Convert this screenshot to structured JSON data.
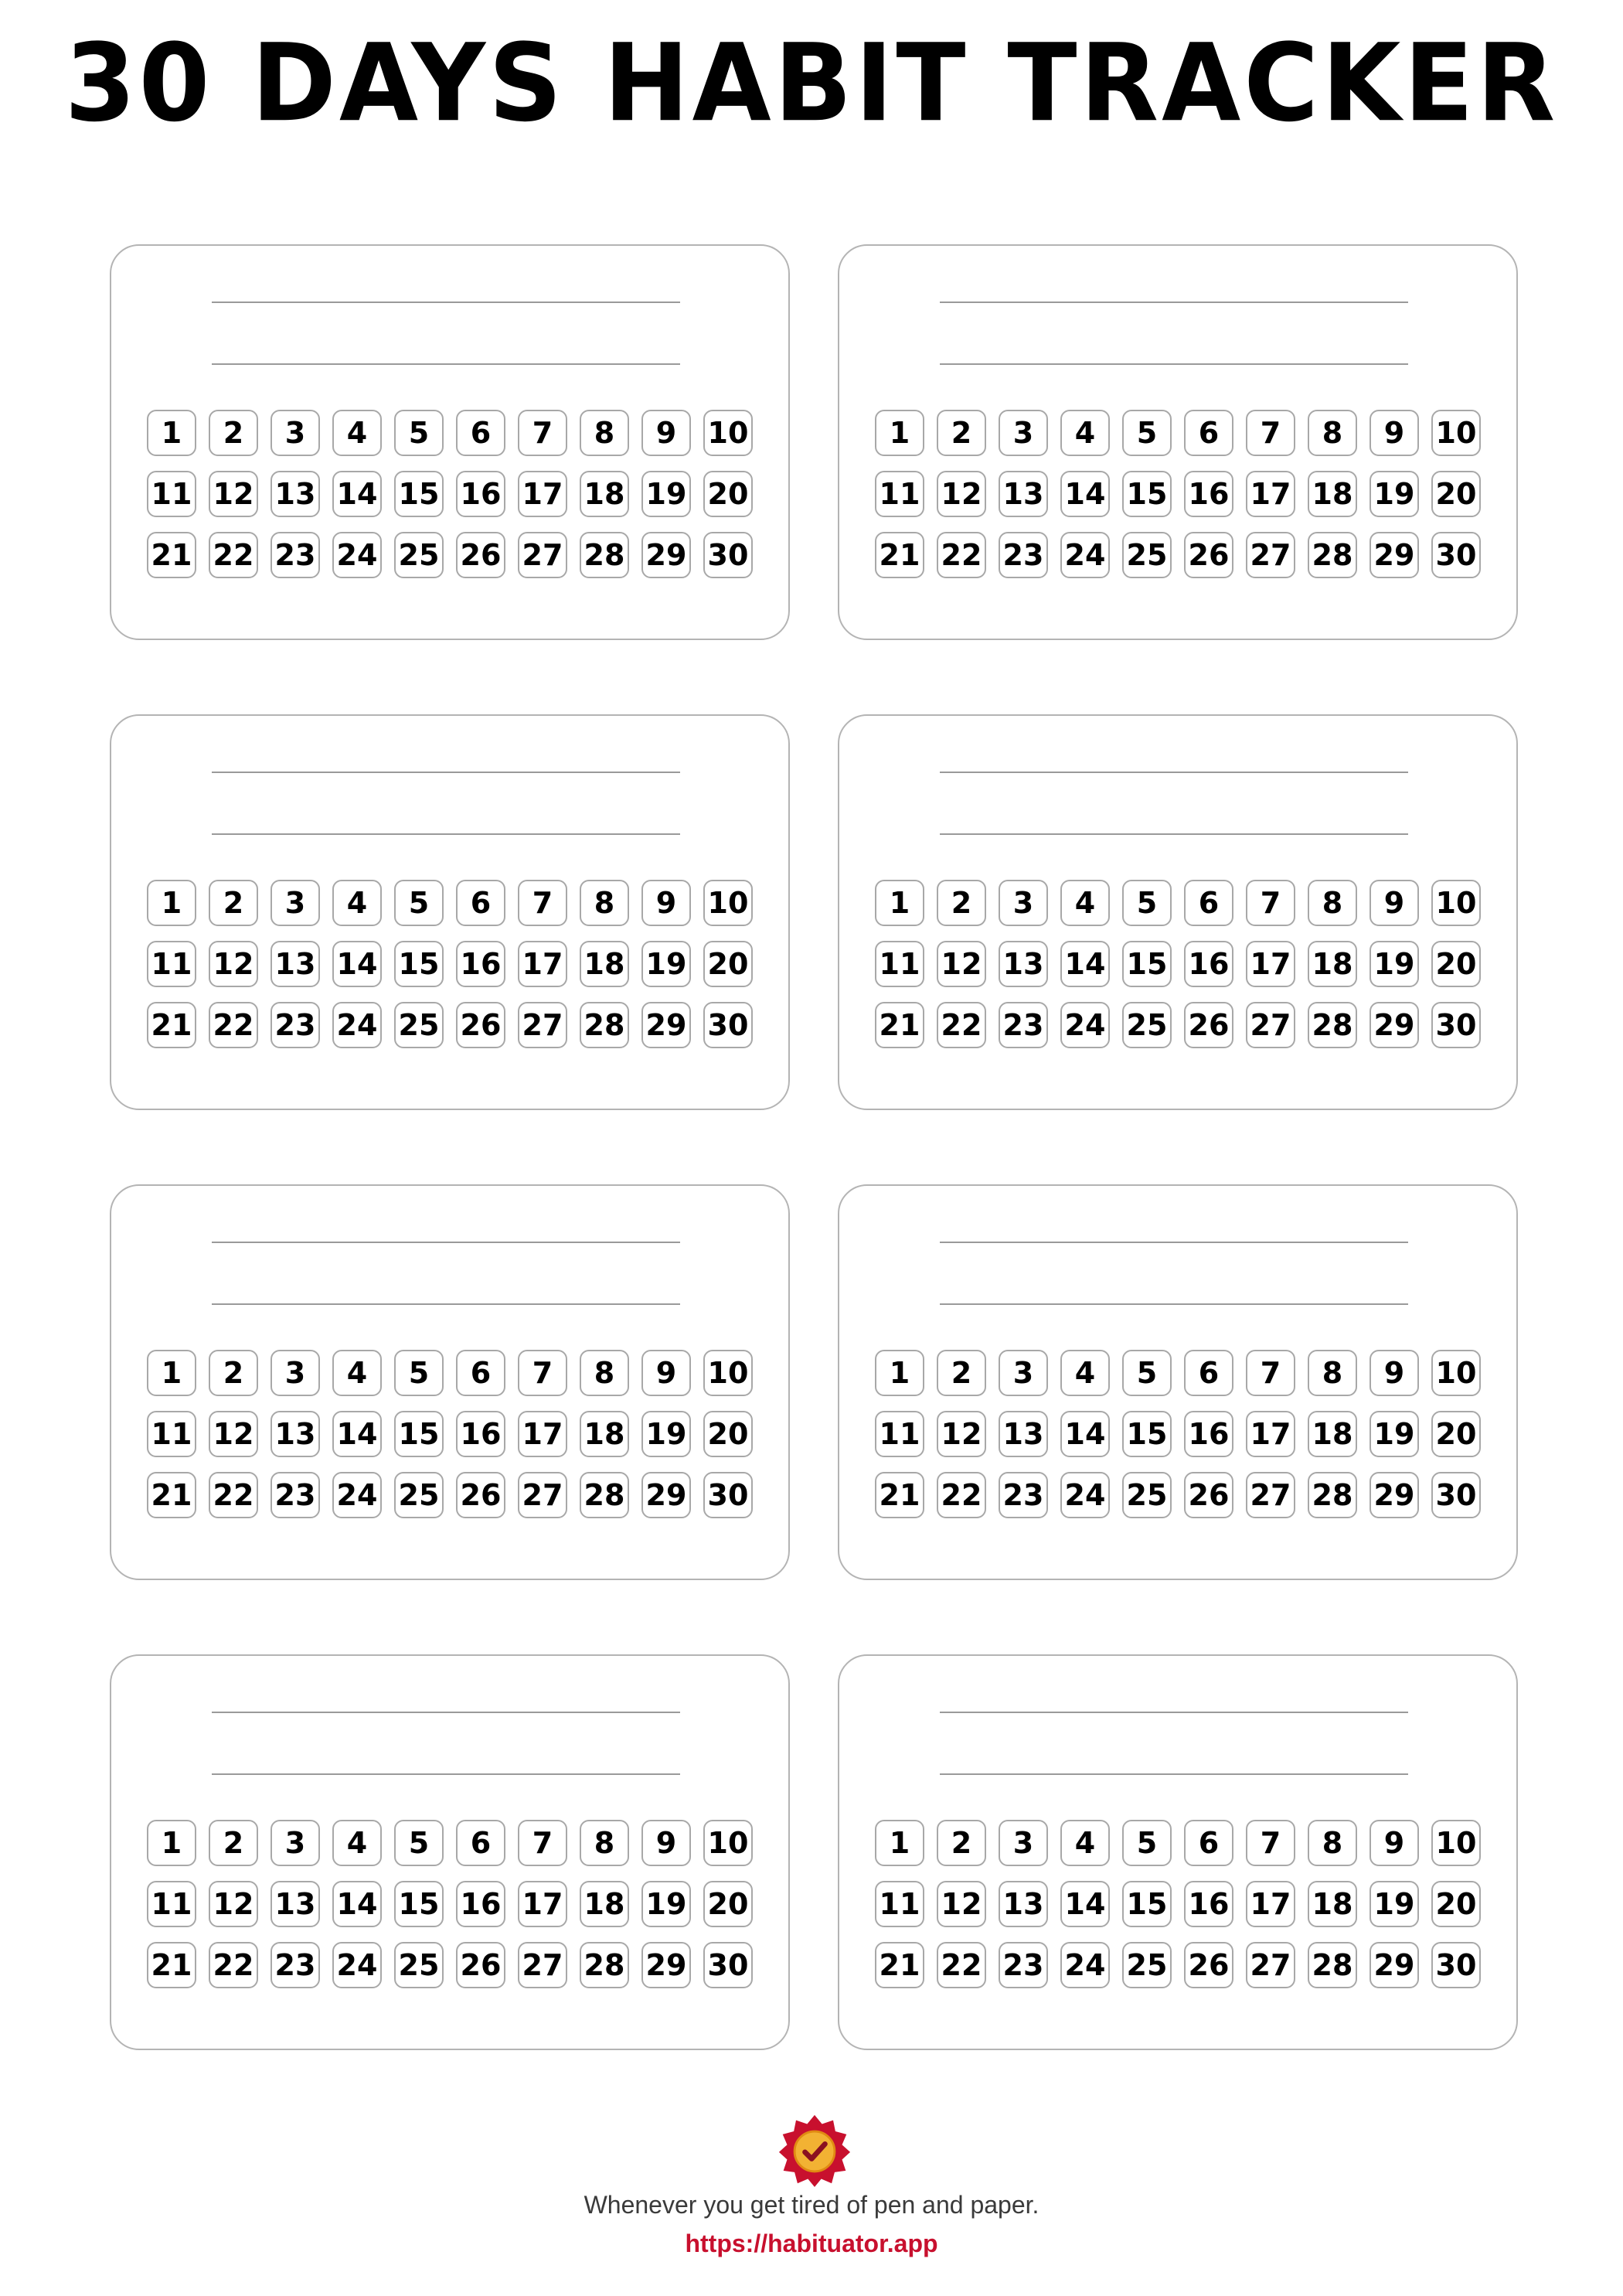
{
  "title": "30 DAYS HABIT TRACKER",
  "tracker": {
    "card_count": 8,
    "days": [
      "1",
      "2",
      "3",
      "4",
      "5",
      "6",
      "7",
      "8",
      "9",
      "10",
      "11",
      "12",
      "13",
      "14",
      "15",
      "16",
      "17",
      "18",
      "19",
      "20",
      "21",
      "22",
      "23",
      "24",
      "25",
      "26",
      "27",
      "28",
      "29",
      "30"
    ]
  },
  "footer": {
    "logo_icon": "seal-checkmark-icon",
    "tagline": "Whenever you get tired of pen and paper.",
    "link": "https://habituator.app"
  },
  "colors": {
    "link": "#c8102e",
    "logo_seal": "#c8102e",
    "logo_badge": "#f2b233"
  }
}
